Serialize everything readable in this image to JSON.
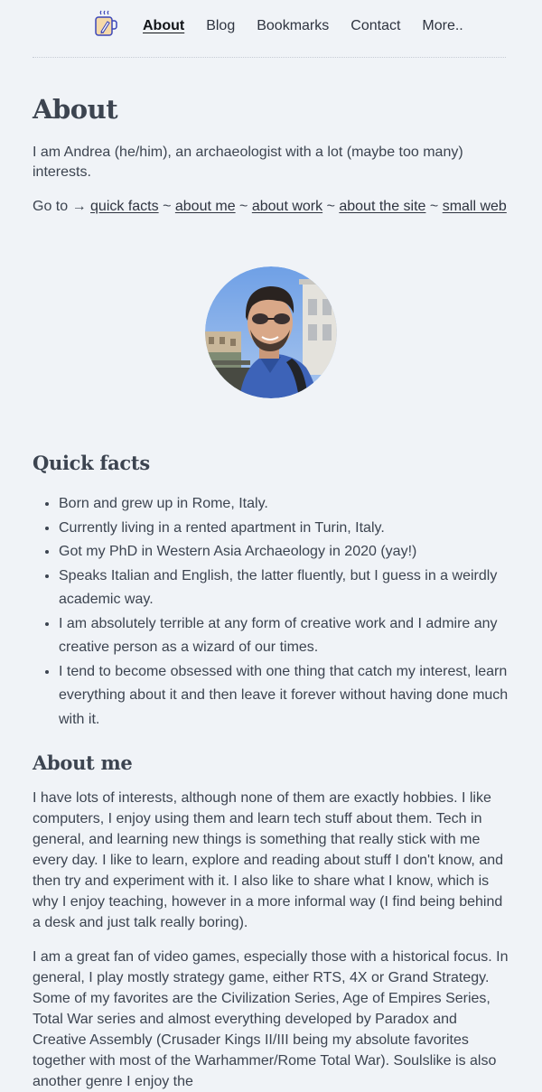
{
  "nav": {
    "logo_icon": "mug-with-pencil-icon",
    "links": [
      {
        "label": "About",
        "active": true
      },
      {
        "label": "Blog"
      },
      {
        "label": "Bookmarks"
      },
      {
        "label": "Contact"
      },
      {
        "label": "More.."
      }
    ]
  },
  "page": {
    "title": "About",
    "intro": "I am Andrea (he/him), an archaeologist with a lot (maybe too many) interests.",
    "goto": {
      "prefix": "Go to →",
      "separator": "~",
      "links": [
        "quick facts",
        "about me",
        "about work",
        "about the site",
        "small web"
      ]
    },
    "avatar_alt": "Portrait photo"
  },
  "quick_facts": {
    "heading": "Quick facts",
    "items": [
      "Born and grew up in Rome, Italy.",
      "Currently living in a rented apartment in Turin, Italy.",
      "Got my PhD in Western Asia Archaeology in 2020 (yay!)",
      "Speaks Italian and English, the latter fluently, but I guess in a weirdly academic way.",
      "I am absolutely terrible at any form of creative work and I admire any creative person as a wizard of our times.",
      "I tend to become obsessed with one thing that catch my interest, learn everything about it and then leave it forever without having done much with it."
    ]
  },
  "about_me": {
    "heading": "About me",
    "paragraphs": [
      "I have lots of interests, although none of them are exactly hobbies. I like computers, I enjoy using them and learn tech stuff about them. Tech in general, and learning new things is something that really stick with me every day. I like to learn, explore and reading about stuff I don't know, and then try and experiment with it. I also like to share what I know, which is why I enjoy teaching, however in a more informal way (I find being behind a desk and just talk really boring).",
      "I am a great fan of video games, especially those with a historical focus. In general, I play mostly strategy game, either RTS, 4X or Grand Strategy. Some of my favorites are the Civilization Series, Age of Empires Series, Total War series and almost everything developed by Paradox and Creative Assembly (Crusader Kings II/III being my absolute favorites together with most of the Warhammer/Rome Total War). Soulslike is also another genre I enjoy the"
    ]
  },
  "colors": {
    "background": "#f0f3f7",
    "text": "#3c4450",
    "link": "#2e3440",
    "logo_accent": "#3b46b8"
  }
}
